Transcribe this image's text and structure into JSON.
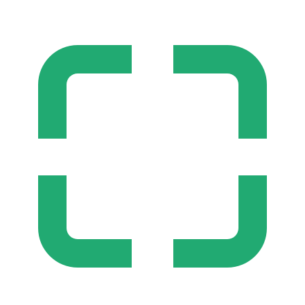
{
  "icon": {
    "name": "scan-frame-icon",
    "color": "#21AA72",
    "background": "#FFFFFF"
  }
}
